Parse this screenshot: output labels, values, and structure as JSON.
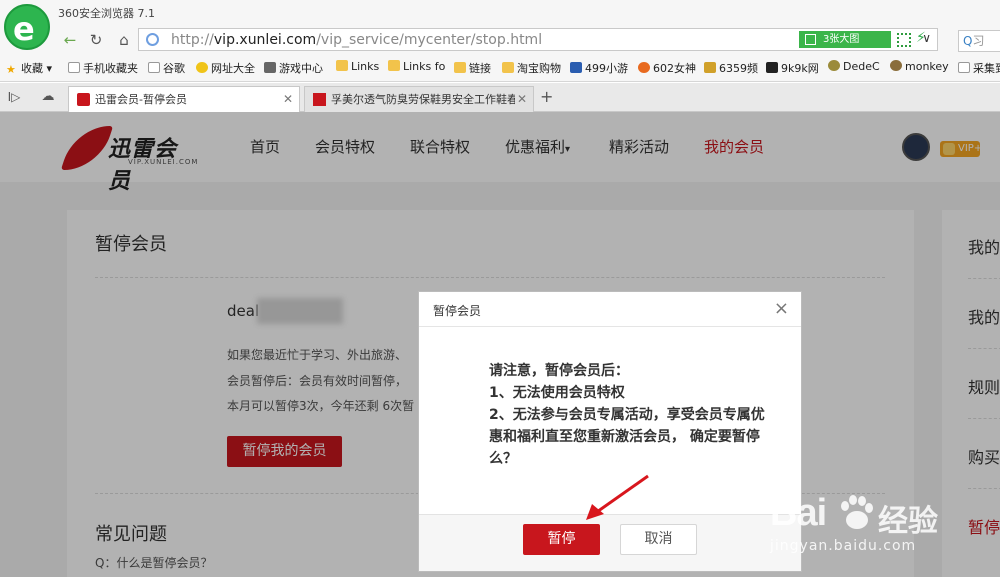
{
  "browser": {
    "title": "360安全浏览器 7.1",
    "url_prefix": "http://",
    "url_domain": "vip.xunlei.com",
    "url_path": "/vip_service/mycenter/stop.html",
    "bigpic_label": "3张大图",
    "search_placeholder": "习"
  },
  "bookmarks": [
    {
      "label": "收藏",
      "icon": "star-icon"
    },
    {
      "label": "手机收藏夹",
      "icon": "page-icon"
    },
    {
      "label": "谷歌",
      "icon": "page-icon"
    },
    {
      "label": "网址大全",
      "icon": "site-icon"
    },
    {
      "label": "游戏中心",
      "icon": "gamepad-icon"
    },
    {
      "label": "Links",
      "icon": "folder-icon"
    },
    {
      "label": "Links fo",
      "icon": "folder-icon"
    },
    {
      "label": "链接",
      "icon": "folder-icon"
    },
    {
      "label": "淘宝购物",
      "icon": "folder-icon"
    },
    {
      "label": "499小游",
      "icon": "site-icon"
    },
    {
      "label": "602女神",
      "icon": "site-icon"
    },
    {
      "label": "6359频",
      "icon": "site-icon"
    },
    {
      "label": "9k9k网",
      "icon": "site-icon"
    },
    {
      "label": "DedeC",
      "icon": "site-icon"
    },
    {
      "label": "monkey",
      "icon": "site-icon"
    },
    {
      "label": "采集到",
      "icon": "page-icon"
    }
  ],
  "tabs": [
    {
      "label": "迅雷会员-暂停会员",
      "active": true
    },
    {
      "label": "孚美尔透气防臭劳保鞋男安全工作鞋春",
      "active": false
    }
  ],
  "site": {
    "logo_name": "迅雷会员",
    "logo_sub": "VIP.XUNLEI.COM",
    "nav": [
      "首页",
      "会员特权",
      "联合特权",
      "优惠福利",
      "精彩活动",
      "我的会员"
    ],
    "dropdown_mark": "▾",
    "vip_badge": "VIP+"
  },
  "main": {
    "title": "暂停会员",
    "account_prefix": "deal",
    "desc_lines": [
      "如果您最近忙于学习、外出旅游、",
      "会员暂停后：会员有效时间暂停，",
      "本月可以暂停3次，今年还剩 6次暂"
    ],
    "pause_button": "暂停我的会员",
    "faq_title": "常见问题",
    "faq_q1": "Q：什么是暂停会员？"
  },
  "sidebar": [
    "我的",
    "我的",
    "规则",
    "购买",
    "暂停"
  ],
  "modal": {
    "title": "暂停会员",
    "close": "×",
    "lines": [
      "请注意，暂停会员后：",
      "1、无法使用会员特权",
      "2、无法参与会员专属活动，享受会员专属优",
      "惠和福利直至您重新激活会员， 确定要暂停",
      "么？"
    ],
    "confirm": "暂停",
    "cancel": "取消"
  },
  "colors": {
    "brand_red": "#c8161d",
    "browser_green": "#3bb54a"
  },
  "watermark": {
    "main": "Bai",
    "cn": "经验",
    "url": "jingyan.baidu.com"
  }
}
